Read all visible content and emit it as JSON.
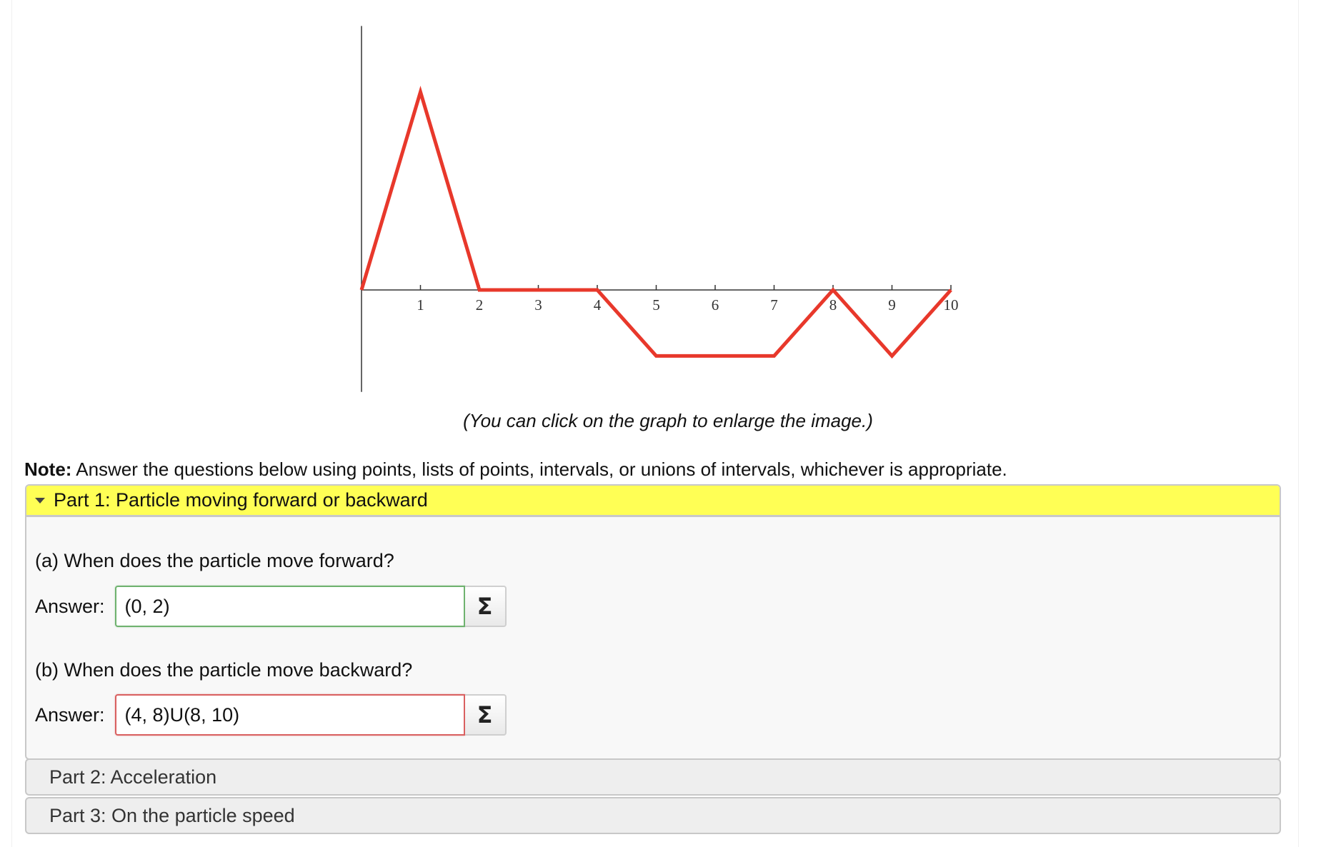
{
  "graph": {
    "x_ticks": [
      "1",
      "2",
      "3",
      "4",
      "5",
      "6",
      "7",
      "8",
      "9",
      "10"
    ],
    "line_color": "#e8382b",
    "axis_color": "#333333",
    "points": [
      [
        0,
        0
      ],
      [
        1,
        3.3
      ],
      [
        2,
        0
      ],
      [
        4,
        0
      ],
      [
        5,
        -1.1
      ],
      [
        7,
        -1.1
      ],
      [
        8,
        0
      ],
      [
        9,
        -1.1
      ],
      [
        10,
        0
      ]
    ],
    "xlim": [
      0,
      10
    ],
    "ylim": [
      -1.7,
      4.4
    ]
  },
  "caption": "(You can click on the graph to enlarge the image.)",
  "note": {
    "label": "Note:",
    "text": " Answer the questions below using points, lists of points, intervals, or unions of intervals, whichever is appropriate."
  },
  "part1": {
    "title": "Part 1: Particle moving forward or backward",
    "question_a": "(a) When does the particle move forward?",
    "answer_label_a": "Answer:",
    "answer_a": "(0, 2)",
    "question_b": "(b) When does the particle move backward?",
    "answer_label_b": "Answer:",
    "answer_b": "(4, 8)U(8, 10)",
    "sigma": "Σ"
  },
  "part2": {
    "title": "Part 2: Acceleration"
  },
  "part3": {
    "title": "Part 3: On the particle speed"
  },
  "colors": {
    "header_highlight": "#ffff55",
    "correct_border": "#6fb26f",
    "wrong_border": "#d96060"
  }
}
